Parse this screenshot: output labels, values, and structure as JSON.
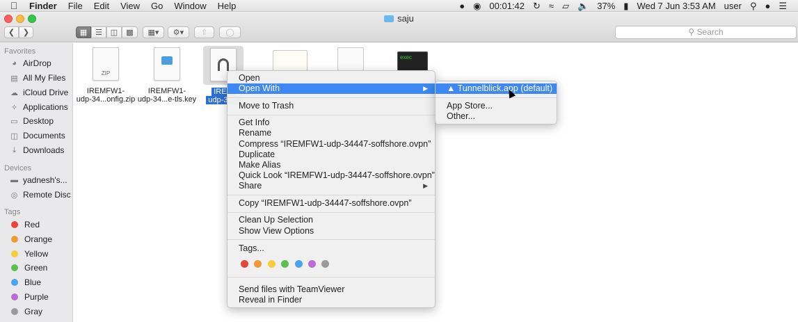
{
  "menubar": {
    "items": [
      "Finder",
      "File",
      "Edit",
      "View",
      "Go",
      "Window",
      "Help"
    ],
    "timer": "00:01:42",
    "battery": "37%",
    "datetime": "Wed 7 Jun  3:53 AM",
    "user": "user"
  },
  "window": {
    "title": "saju"
  },
  "toolbar": {
    "search_placeholder": "Search"
  },
  "sidebar": {
    "favorites_header": "Favorites",
    "favorites": [
      "AirDrop",
      "All My Files",
      "iCloud Drive",
      "Applications",
      "Desktop",
      "Documents",
      "Downloads"
    ],
    "devices_header": "Devices",
    "devices": [
      "yadnesh's...",
      "Remote Disc"
    ],
    "tags_header": "Tags",
    "tags": [
      {
        "name": "Red",
        "color": "#e8453c"
      },
      {
        "name": "Orange",
        "color": "#f09a37"
      },
      {
        "name": "Yellow",
        "color": "#f5cd3d"
      },
      {
        "name": "Green",
        "color": "#5ac04f"
      },
      {
        "name": "Blue",
        "color": "#4aa3ee"
      },
      {
        "name": "Purple",
        "color": "#bc6ad6"
      },
      {
        "name": "Gray",
        "color": "#9a9a9a"
      }
    ]
  },
  "files": [
    {
      "line1": "IREMFW1-",
      "line2": "udp-34...onfig.zip",
      "badge": "ZIP"
    },
    {
      "line1": "IREMFW1-",
      "line2": "udp-34...e-tls.key",
      "badge": ""
    },
    {
      "line1": "IREM",
      "line2": "udp-34...",
      "badge": ""
    }
  ],
  "exec_label": "exec",
  "context_menu": {
    "open": "Open",
    "open_with": "Open With",
    "move_to_trash": "Move to Trash",
    "get_info": "Get Info",
    "rename": "Rename",
    "compress": "Compress “IREMFW1-udp-34447-soffshore.ovpn”",
    "duplicate": "Duplicate",
    "make_alias": "Make Alias",
    "quick_look": "Quick Look “IREMFW1-udp-34447-soffshore.ovpn”",
    "share": "Share",
    "copy": "Copy “IREMFW1-udp-34447-soffshore.ovpn”",
    "clean_up": "Clean Up Selection",
    "show_view_options": "Show View Options",
    "tags": "Tags...",
    "tag_colors": [
      "#e8453c",
      "#f09a37",
      "#f5cd3d",
      "#5ac04f",
      "#4aa3ee",
      "#bc6ad6",
      "#9a9a9a"
    ],
    "send_teamviewer": "Send files with TeamViewer",
    "reveal_in_finder": "Reveal in Finder"
  },
  "open_with_menu": {
    "default_app": "Tunnelblick.app (default)",
    "app_store": "App Store...",
    "other": "Other..."
  },
  "accent_color": "#3d88f2"
}
